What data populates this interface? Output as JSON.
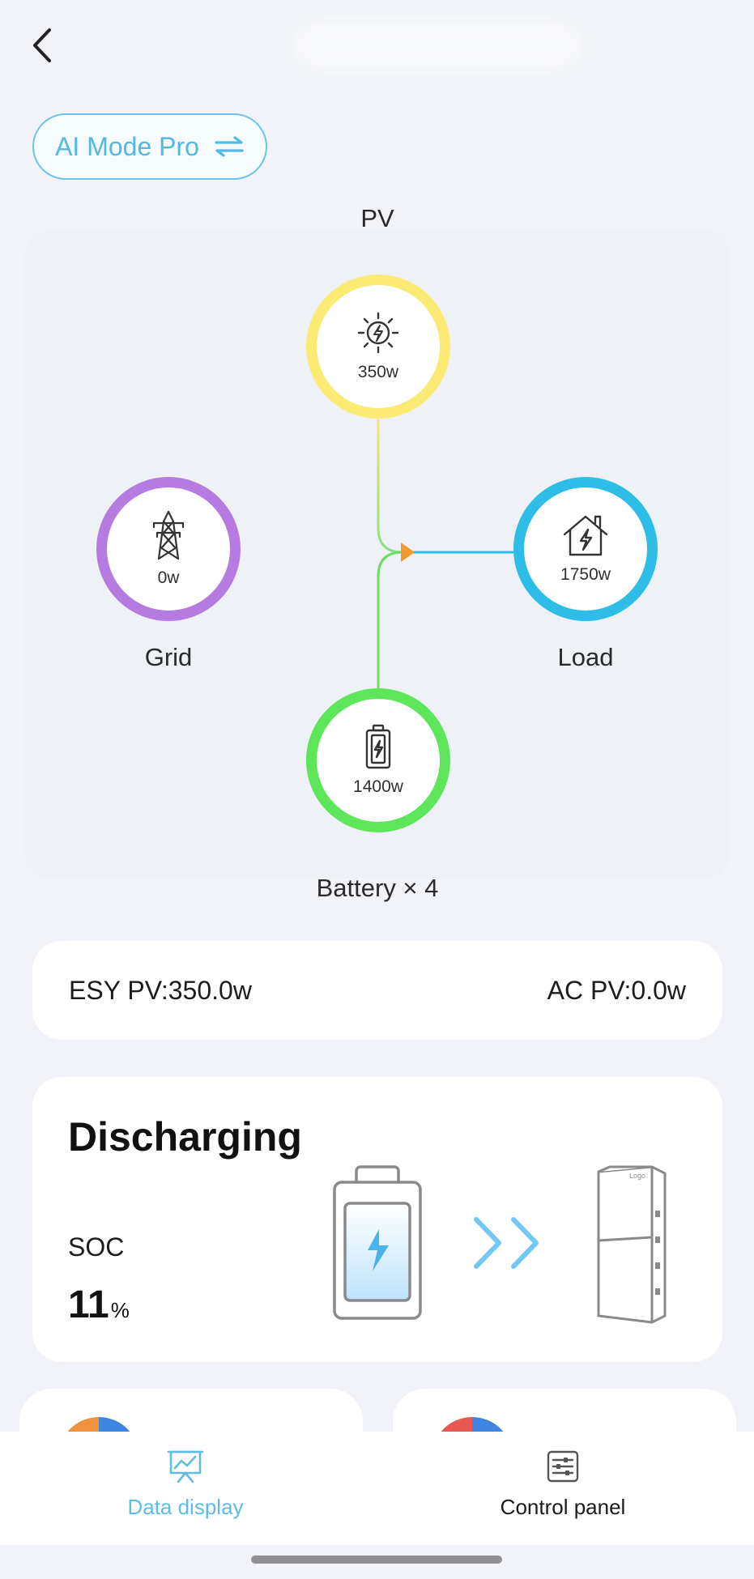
{
  "header": {
    "back_icon": "chevron-left-icon"
  },
  "mode": {
    "label": "AI Mode Pro",
    "icon": "swap-arrows-icon"
  },
  "flow": {
    "pv": {
      "label": "PV",
      "value": "350w",
      "icon": "solar-sun-bolt-icon",
      "color": "#fbea73"
    },
    "grid": {
      "label": "Grid",
      "value": "0w",
      "icon": "power-tower-icon",
      "color": "#b57be0"
    },
    "load": {
      "label": "Load",
      "value": "1750w",
      "icon": "house-bolt-icon",
      "color": "#2dbde6"
    },
    "battery": {
      "label": "Battery × 4",
      "value": "1400w",
      "icon": "battery-bolt-icon",
      "color": "#5ee65a"
    },
    "junction_color": "#f39a2d"
  },
  "pv_summary": {
    "esy": "ESY PV:350.0w",
    "ac": "AC PV:0.0w"
  },
  "status": {
    "title": "Discharging",
    "soc_label": "SOC",
    "soc_value": "11",
    "soc_unit": "%",
    "device_logo": "Logo"
  },
  "nav": {
    "data_display": {
      "label": "Data display",
      "icon": "presentation-chart-icon",
      "active": true,
      "color": "#5ebde6"
    },
    "control_panel": {
      "label": "Control panel",
      "icon": "sliders-panel-icon",
      "active": false
    }
  }
}
